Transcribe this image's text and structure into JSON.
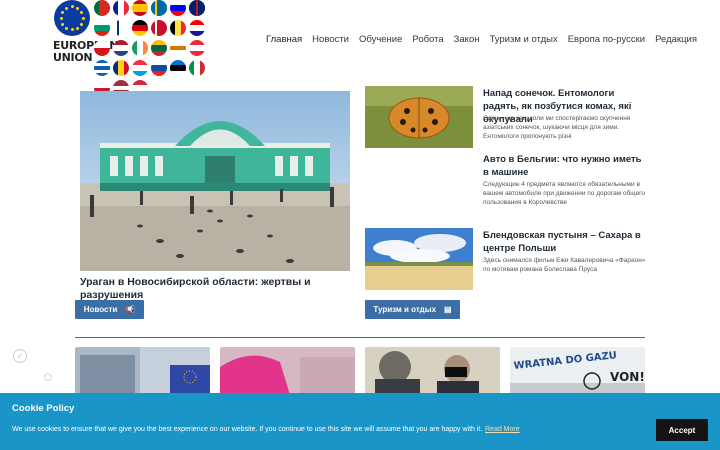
{
  "logo": {
    "line1": "EUROPEAN",
    "line2": "UNION"
  },
  "nav": {
    "items": [
      "Главная",
      "Новости",
      "Обучение",
      "Робота",
      "Закон",
      "Туризм и отдых",
      "Европа по-русски",
      "Редакция"
    ]
  },
  "hero": {
    "title": "Ураган в Новосибирской области: жертвы и разрушения",
    "button_label": "Новости",
    "button_icon": "megaphone-icon"
  },
  "side_articles": [
    {
      "title": "Напад сонечок. Ентомологи радять, як позбутися комах, які окупували",
      "text": "Осінь – це час, коли ми спостерігаємо скупчення азіатських сонечок, шукаючи місця для зими. Ентомологи пропонують різні"
    },
    {
      "title": "Авто в Бельгии: что нужно иметь в машине",
      "text": "Следующие 4 предмета являются обязательными в вашем автомобиле при движении по дорогам общего пользования в Королевстве"
    },
    {
      "title": "Блендовская пустыня – Сахара в центре Польши",
      "text": "Здесь снимался фильм Ежи Кавалеровича «Фараон» по мотивам романа Болеслава Пруса"
    }
  ],
  "travel_button": {
    "label": "Туризм и отдых",
    "icon": "card-icon"
  },
  "thumb_text": {
    "graffiti_1": "WRATNA DO GAZU",
    "graffiti_2": "VON!"
  },
  "cookie": {
    "title": "Cookie Policy",
    "text": "We use cookies to ensure that we give you the best experience on our website. If you continue to use this site we will assume that you are happy with it.",
    "link": "Read More",
    "accept": "Accept"
  },
  "colors": {
    "accent": "#3a6ea5",
    "cookie_bg": "#1a95c8",
    "accept_bg": "#141414"
  }
}
